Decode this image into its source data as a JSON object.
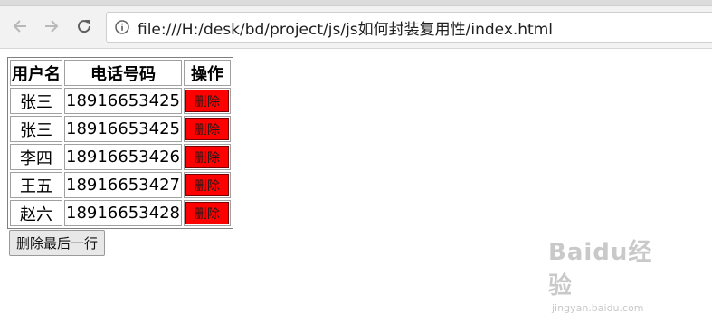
{
  "browser": {
    "url": "file:///H:/desk/bd/project/js/js如何封装复用性/index.html",
    "icons": {
      "back": "arrow-left-icon",
      "forward": "arrow-right-icon",
      "reload": "reload-icon",
      "info": "info-icon"
    }
  },
  "table": {
    "headers": [
      "用户名",
      "电话号码",
      "操作"
    ],
    "rows": [
      {
        "name": "张三",
        "phone": "18916653425",
        "action": "删除"
      },
      {
        "name": "张三",
        "phone": "18916653425",
        "action": "删除"
      },
      {
        "name": "李四",
        "phone": "18916653426",
        "action": "删除"
      },
      {
        "name": "王五",
        "phone": "18916653427",
        "action": "删除"
      },
      {
        "name": "赵六",
        "phone": "18916653428",
        "action": "删除"
      }
    ]
  },
  "delete_last_label": "删除最后一行",
  "colors": {
    "delete_button": "#ff0000"
  },
  "watermark": {
    "main": "Baidu经验",
    "sub": "jingyan.baidu.com"
  }
}
